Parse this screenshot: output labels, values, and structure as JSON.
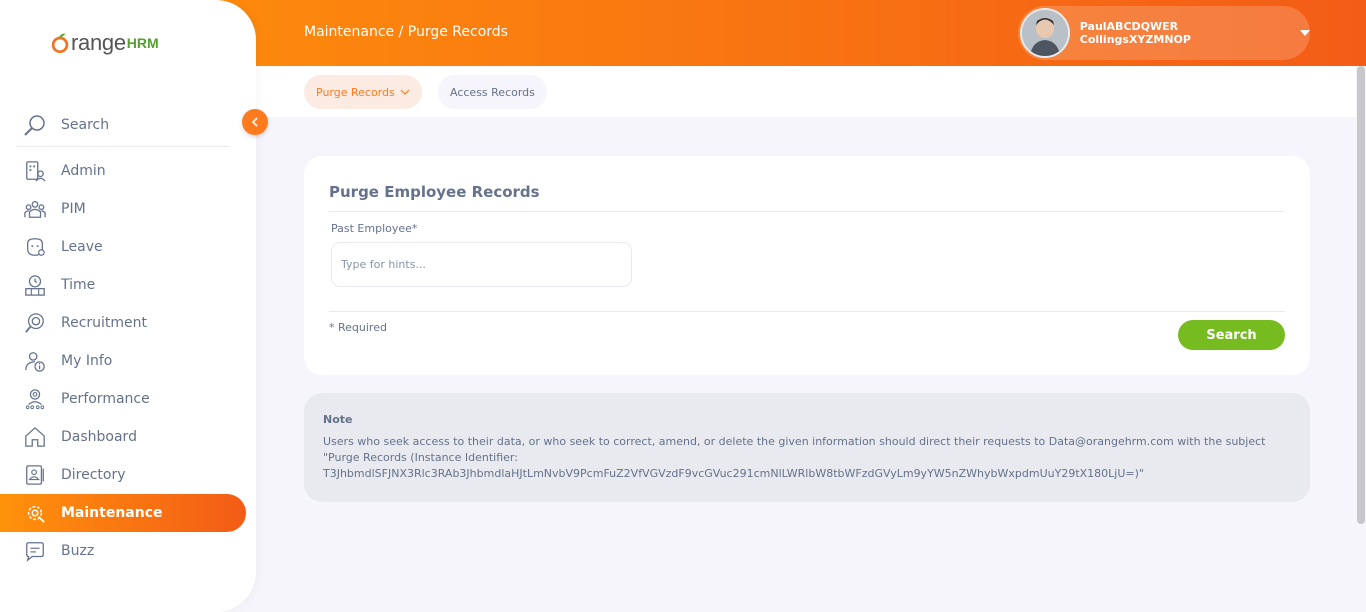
{
  "brand": {
    "name_main": "range",
    "name_suffix": "HRM"
  },
  "sidebar": {
    "search_label": "Search",
    "items": [
      {
        "label": "Admin",
        "icon": "admin-icon"
      },
      {
        "label": "PIM",
        "icon": "pim-icon"
      },
      {
        "label": "Leave",
        "icon": "leave-icon"
      },
      {
        "label": "Time",
        "icon": "time-icon"
      },
      {
        "label": "Recruitment",
        "icon": "recruitment-icon"
      },
      {
        "label": "My Info",
        "icon": "my-info-icon"
      },
      {
        "label": "Performance",
        "icon": "performance-icon"
      },
      {
        "label": "Dashboard",
        "icon": "dashboard-icon"
      },
      {
        "label": "Directory",
        "icon": "directory-icon"
      },
      {
        "label": "Maintenance",
        "icon": "maintenance-icon",
        "active": true
      },
      {
        "label": "Buzz",
        "icon": "buzz-icon"
      }
    ]
  },
  "header": {
    "breadcrumb": "Maintenance / Purge Records",
    "user_name": "PaulABCDQWER CollingsXYZMNOP"
  },
  "tabs": {
    "purge": "Purge Records",
    "access": "Access Records"
  },
  "form": {
    "title": "Purge Employee Records",
    "field_label": "Past Employee*",
    "field_placeholder": "Type for hints...",
    "required_note": "* Required",
    "search_button": "Search"
  },
  "note": {
    "title": "Note",
    "text": "Users who seek access to their data, or who seek to correct, amend, or delete the given information should direct their requests to Data@orangehrm.com with the subject \"Purge Records (Instance Identifier: T3JhbmdlSFJNX3Rlc3RAb3JhbmdlaHJtLmNvbV9PcmFuZ2VfVGVzdF9vcGVuc291cmNlLWRlbW8tbWFzdGVyLm9yYW5nZWhybWxpdmUuY29tX180LjU=)\""
  },
  "colors": {
    "accent": "#ff7b1d",
    "success": "#76bc21",
    "text": "#64728c"
  }
}
